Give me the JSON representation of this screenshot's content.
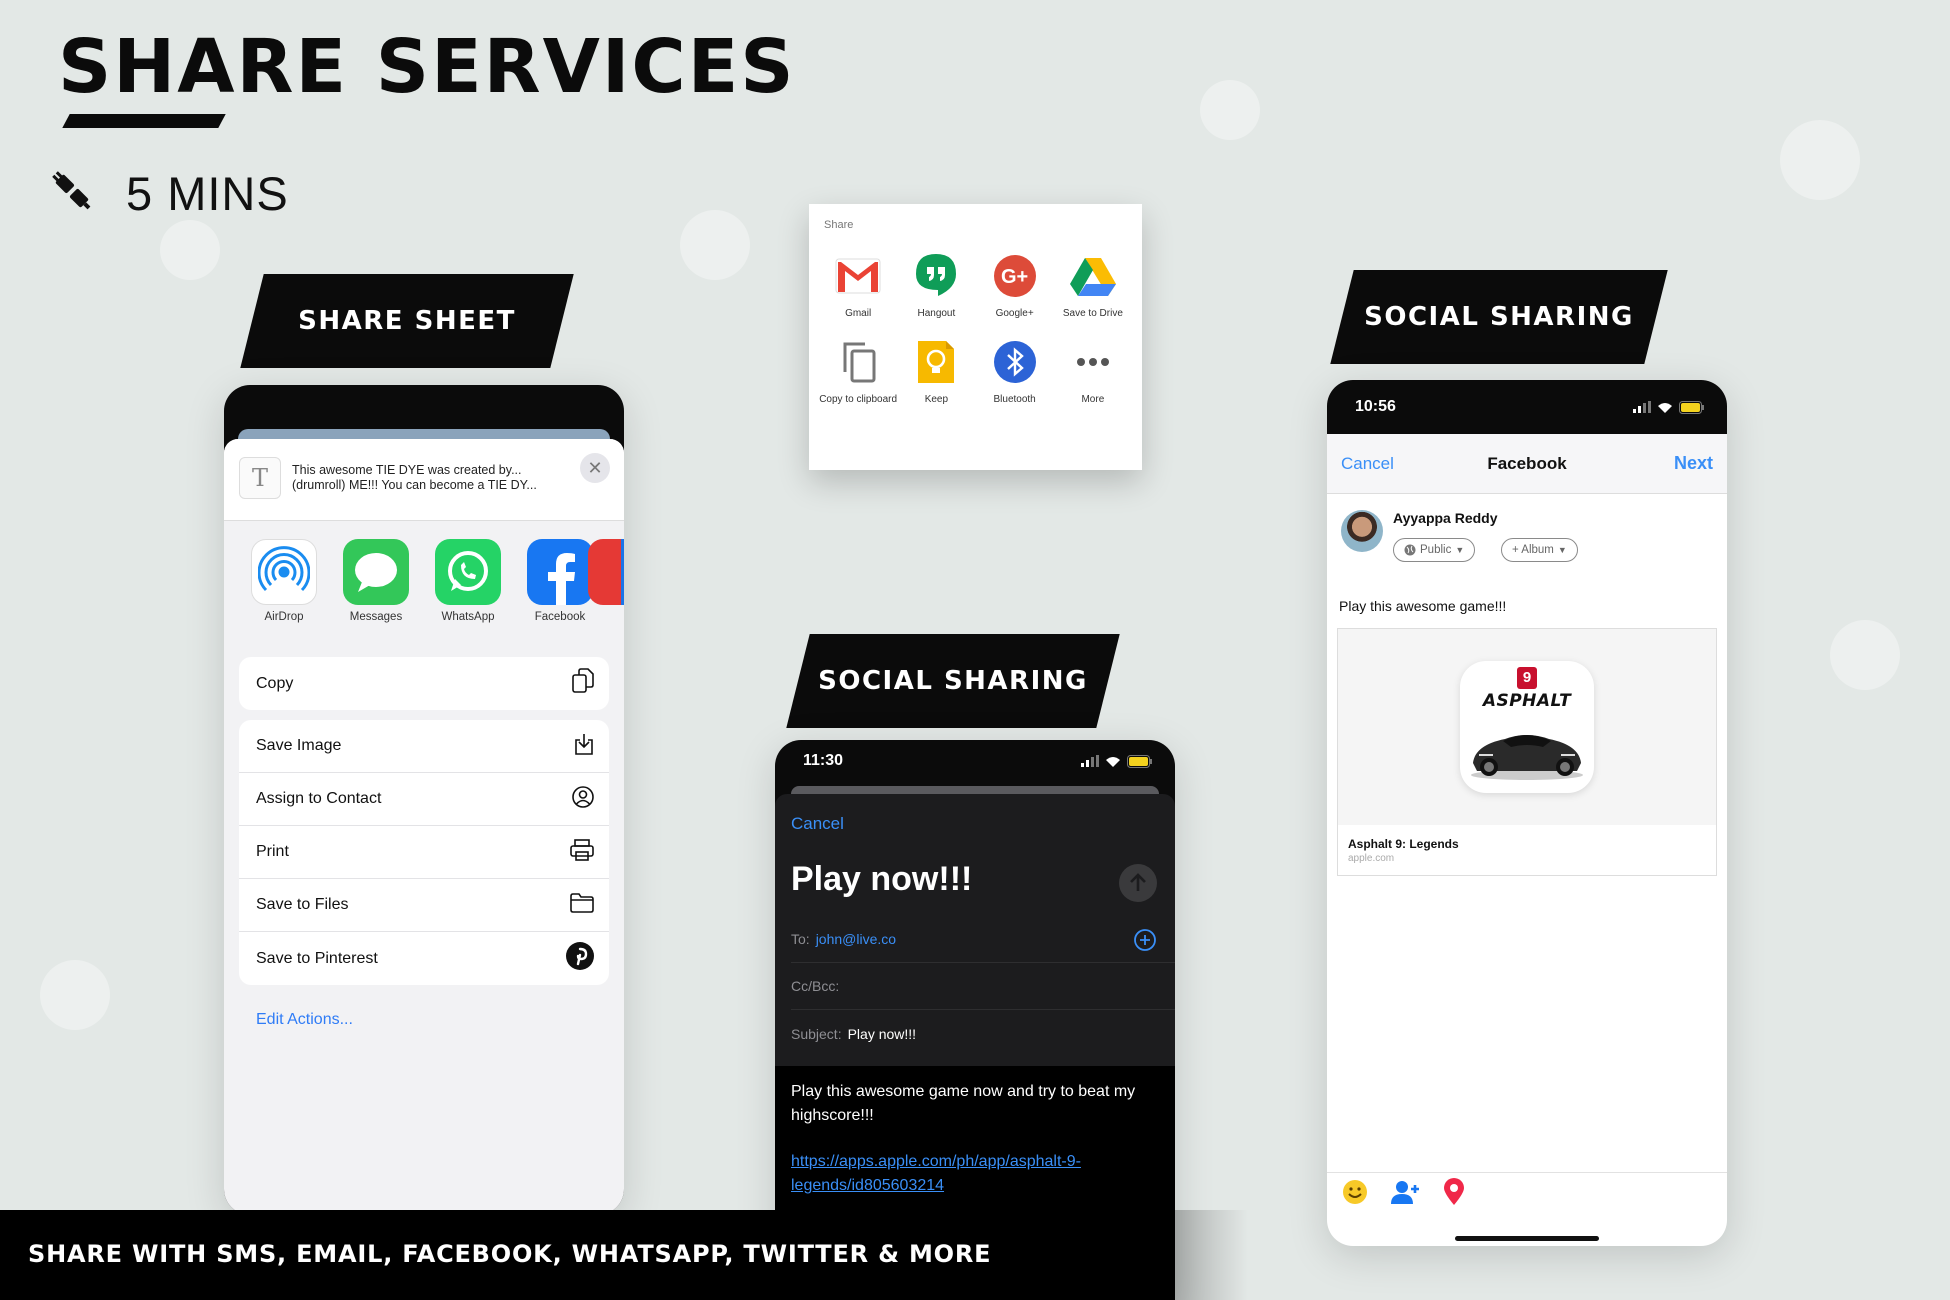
{
  "header": {
    "title": "SHARE SERVICES",
    "duration_icon": "plug-icon",
    "duration": "5 MINS"
  },
  "labels": {
    "share_sheet": "SHARE SHEET",
    "social_sharing_mail": "SOCIAL SHARING",
    "social_sharing_facebook": "SOCIAL SHARING"
  },
  "share_sheet": {
    "preview_icon": "text-document-icon",
    "preview_text": "This awesome TIE DYE was created by... (drumroll) ME!!! You can become a TIE DY...",
    "apps": [
      {
        "label": "AirDrop",
        "icon": "airdrop-icon",
        "color": "#1a8cf0"
      },
      {
        "label": "Messages",
        "icon": "messages-icon",
        "color": "#33c759"
      },
      {
        "label": "WhatsApp",
        "icon": "whatsapp-icon",
        "color": "#25d366"
      },
      {
        "label": "Facebook",
        "icon": "facebook-icon",
        "color": "#1877f2"
      }
    ],
    "actions": [
      {
        "label": "Copy",
        "icon": "copy-icon"
      },
      {
        "label": "Save Image",
        "icon": "download-icon"
      },
      {
        "label": "Assign to Contact",
        "icon": "contact-icon"
      },
      {
        "label": "Print",
        "icon": "printer-icon"
      },
      {
        "label": "Save to Files",
        "icon": "folder-icon"
      },
      {
        "label": "Save to Pinterest",
        "icon": "pinterest-icon"
      }
    ],
    "edit_actions": "Edit Actions..."
  },
  "android_share": {
    "title": "Share",
    "items": [
      {
        "label": "Gmail",
        "icon": "gmail-icon",
        "color": "#ea4335"
      },
      {
        "label": "Hangout",
        "icon": "hangouts-icon",
        "color": "#0f9d58"
      },
      {
        "label": "Google+",
        "icon": "google-plus-icon",
        "color": "#dd4b39"
      },
      {
        "label": "Save to Drive",
        "icon": "drive-icon",
        "color": "#fbbc04"
      },
      {
        "label": "Copy to clipboard",
        "icon": "clipboard-icon",
        "color": "#777777"
      },
      {
        "label": "Keep",
        "icon": "keep-icon",
        "color": "#f7b900"
      },
      {
        "label": "Bluetooth",
        "icon": "bluetooth-icon",
        "color": "#2c63d6"
      },
      {
        "label": "More",
        "icon": "more-icon",
        "color": "#555555"
      }
    ]
  },
  "mail": {
    "time": "11:30",
    "cancel": "Cancel",
    "title": "Play now!!!",
    "to_label": "To:",
    "to_value": "john@live.co",
    "cc_label": "Cc/Bcc:",
    "subject_label": "Subject:",
    "subject_value": "Play now!!!",
    "body": "Play this awesome game now and try to beat my highscore!!!",
    "link": "https://apps.apple.com/ph/app/asphalt-9-legends/id805603214"
  },
  "facebook": {
    "time": "10:56",
    "cancel": "Cancel",
    "title": "Facebook",
    "next": "Next",
    "user_name": "Ayyappa Reddy",
    "audience": "Public",
    "album": "+ Album",
    "message": "Play this awesome game!!!",
    "app_badge": "9",
    "app_logo_text": "ASPHALT",
    "link_title": "Asphalt 9: Legends",
    "link_domain": "apple.com",
    "toolbar_icons": [
      "emoji-icon",
      "tag-people-icon",
      "location-icon"
    ]
  },
  "footer": {
    "banner": "SHARE WITH SMS, EMAIL, FACEBOOK, WHATSAPP, TWITTER & MORE"
  },
  "colors": {
    "background": "#e3e8e6",
    "ios_blue": "#3a8ff7",
    "label_black": "#0b0b0b"
  }
}
